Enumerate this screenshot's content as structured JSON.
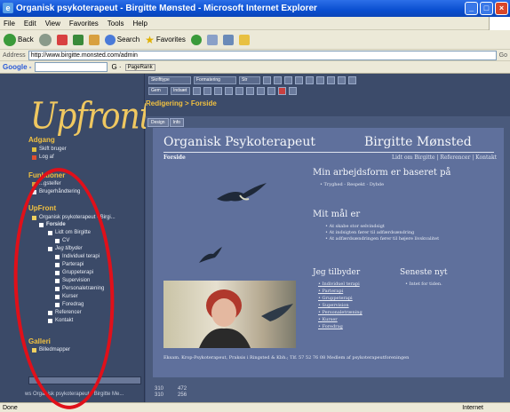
{
  "window": {
    "title": "Organisk psykoterapeut - Birgitte Mønsted - Microsoft Internet Explorer"
  },
  "menu": [
    "File",
    "Edit",
    "View",
    "Favorites",
    "Tools",
    "Help"
  ],
  "toolbar": {
    "back": "Back",
    "search": "Search",
    "favorites": "Favorites"
  },
  "address": {
    "label": "Address",
    "url": "http://www.birgitte.monsted.com/admin",
    "go": "Go"
  },
  "google_bar": {
    "label": "Google -",
    "pagerank": "PageRank"
  },
  "sidebar": {
    "logo": "Upfront",
    "sections": [
      {
        "title": "Adgang",
        "items": [
          "Skift bruger",
          "Log af"
        ]
      },
      {
        "title": "Funktioner",
        "items": [
          "...gsteifer",
          "Brugerhåndtering"
        ]
      },
      {
        "title": "UpFront",
        "items": [
          "Organisk psykoterapeut - Birgi...",
          "Forside",
          "Lidt om Birgitte",
          "CV",
          "Jeg tilbyder",
          "Individuel terapi",
          "Parterapi",
          "Gruppeterapi",
          "Supervision",
          "Personaletræning",
          "Kurser",
          "Foredrag",
          "Referencer",
          "Kontakt"
        ]
      },
      {
        "title": "Galleri",
        "items": [
          "Billedmapper"
        ]
      }
    ],
    "status": "ws Organisk psykoterapeut - Birgitte Me..."
  },
  "editor": {
    "dropdowns": [
      "Skrifttype",
      "Formatering",
      "Str"
    ],
    "buttons": [
      "Gem",
      "Indsæt"
    ],
    "breadcrumb": "Redigering > Forside",
    "tabs": [
      "Design",
      "Info"
    ]
  },
  "page": {
    "title": "Organisk Psykoterapeut",
    "name": "Birgitte Mønsted",
    "subtitle": "Forside",
    "toplinks": "Lidt om Birgitte | Referencer | Kontakt",
    "h_method": "Min arbejdsform er baseret på",
    "method_item": "Tryghed - Respekt - Dybde",
    "h_goal": "Mit mål er",
    "goal_items": [
      "At skabe stor selvindsigt",
      "At indsigten fører til adfærdsændring",
      "At adfærdsændringen fører til højere livskvalitet"
    ],
    "h_offer": "Jeg tilbyder",
    "offer_items": [
      "Individuel terapi",
      "Parterapi",
      "Gruppeterapi",
      "Supervision",
      "Personaletræning",
      "Kurser",
      "Foredrag"
    ],
    "h_news": "Seneste nyt",
    "news_item": "Intet for tiden.",
    "footer": "Eksam. Krop-Psykoterapeut, Praksis i Ringsted & Kbh.; Tlf. 57 52 76 08     Medlem af psykoterapeutforeningen"
  },
  "dims": {
    "w1": "310",
    "h1": "310",
    "w2": "472",
    "h2": "256"
  },
  "status": {
    "left": "Done",
    "right": "Internet"
  }
}
